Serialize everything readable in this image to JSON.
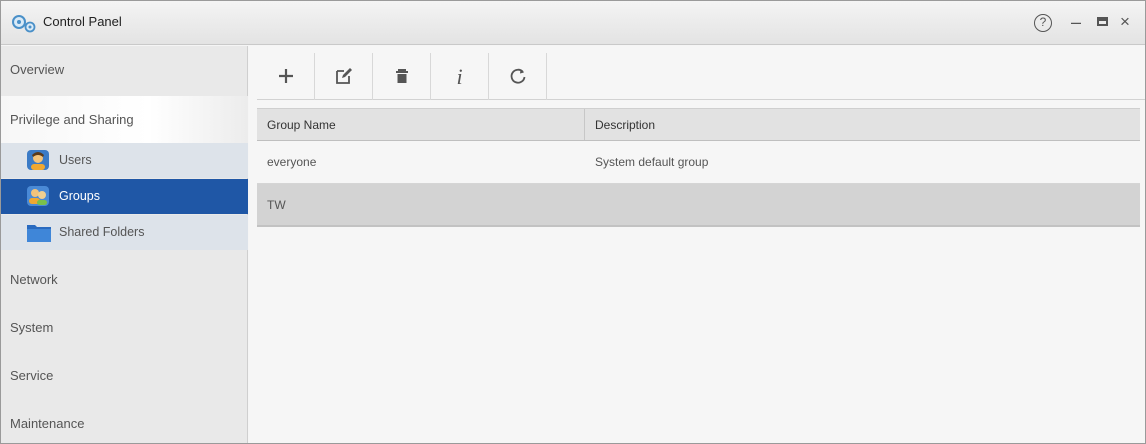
{
  "window": {
    "title": "Control Panel",
    "controls": {
      "help": "?",
      "minimize": "–",
      "close": "×"
    }
  },
  "sidebar": {
    "sections": [
      {
        "label": "Overview"
      },
      {
        "label": "Privilege and Sharing"
      },
      {
        "label": "Network"
      },
      {
        "label": "System"
      },
      {
        "label": "Service"
      },
      {
        "label": "Maintenance"
      }
    ],
    "sub_items": [
      {
        "label": "Users",
        "icon": "user-icon"
      },
      {
        "label": "Groups",
        "icon": "group-icon",
        "selected": true
      },
      {
        "label": "Shared Folders",
        "icon": "folder-icon"
      }
    ]
  },
  "toolbar": {
    "buttons": [
      {
        "icon": "add-icon"
      },
      {
        "icon": "edit-icon"
      },
      {
        "icon": "delete-icon"
      },
      {
        "icon": "info-icon",
        "label": "i"
      },
      {
        "icon": "refresh-icon"
      }
    ]
  },
  "grid": {
    "columns": [
      "Group Name",
      "Description"
    ],
    "rows": [
      {
        "name": "everyone",
        "description": "System default group"
      },
      {
        "name": "TW",
        "description": "",
        "selected": true
      }
    ]
  },
  "colors": {
    "selected_nav": "#1f57a6",
    "sub_nav_bg": "#dde3ea",
    "selected_row": "#d3d3d3"
  }
}
